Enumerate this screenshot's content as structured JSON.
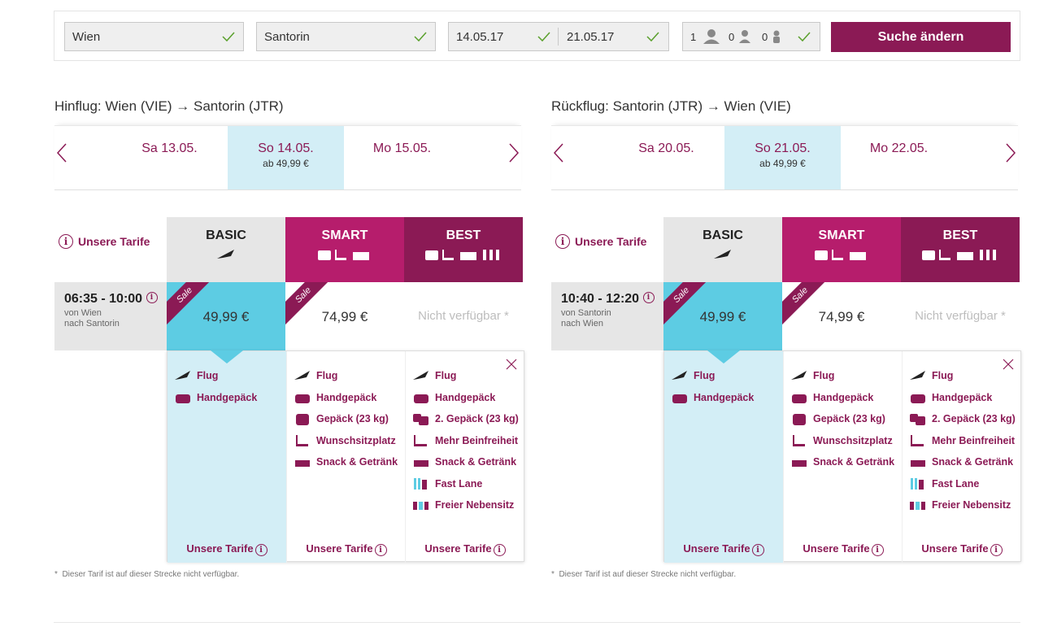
{
  "search": {
    "from": "Wien",
    "to": "Santorin",
    "date_out": "14.05.17",
    "date_back": "21.05.17",
    "adults": "1",
    "children": "0",
    "infants": "0",
    "button": "Suche ändern"
  },
  "outbound": {
    "title": "Hinflug: Wien (VIE) → Santorin (JTR)",
    "dates": [
      {
        "label": "Sa 13.05.",
        "price": ""
      },
      {
        "label": "So 14.05.",
        "price": "ab 49,99 €"
      },
      {
        "label": "Mo 15.05.",
        "price": ""
      }
    ],
    "time": "06:35 - 10:00",
    "from_line": "von Wien",
    "to_line": "nach Santorin",
    "price_basic": "49,99 €",
    "price_smart": "74,99 €",
    "price_best": "Nicht verfügbar *"
  },
  "return": {
    "title": "Rückflug: Santorin (JTR) → Wien (VIE)",
    "dates": [
      {
        "label": "Sa 20.05.",
        "price": ""
      },
      {
        "label": "So 21.05.",
        "price": "ab 49,99 €"
      },
      {
        "label": "Mo 22.05.",
        "price": ""
      }
    ],
    "time": "10:40 - 12:20",
    "from_line": "von Santorin",
    "to_line": "nach Wien",
    "price_basic": "49,99 €",
    "price_smart": "74,99 €",
    "price_best": "Nicht verfügbar *"
  },
  "fares": {
    "link": "Unsere Tarife",
    "basic": "BASIC",
    "smart": "SMART",
    "best": "BEST",
    "sale": "Sale"
  },
  "features": {
    "basic": [
      "Flug",
      "Handgepäck"
    ],
    "smart": [
      "Flug",
      "Handgepäck",
      "Gepäck (23 kg)",
      "Wunschsitzplatz",
      "Snack & Getränk"
    ],
    "best": [
      "Flug",
      "Handgepäck",
      "2. Gepäck (23 kg)",
      "Mehr Beinfreiheit",
      "Snack & Getränk",
      "Fast Lane",
      "Freier Nebensitz"
    ]
  },
  "footnote": "Dieser Tarif ist auf dieser Strecke nicht verfügbar.",
  "colors": {
    "brand": "#8b1a55",
    "smart": "#b61d6c",
    "sale_cell": "#5dcce3",
    "selected": "#d3eef6"
  }
}
